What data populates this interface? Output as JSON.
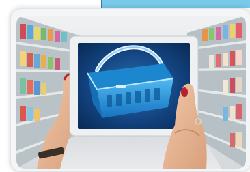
{
  "image": {
    "subject": "shopping-cart-basket-on-tablet-in-supermarket",
    "colors": {
      "tablet_screen": "#11356b",
      "basket": "#1f8fd6",
      "tab_accent": "#79c9ea"
    }
  }
}
